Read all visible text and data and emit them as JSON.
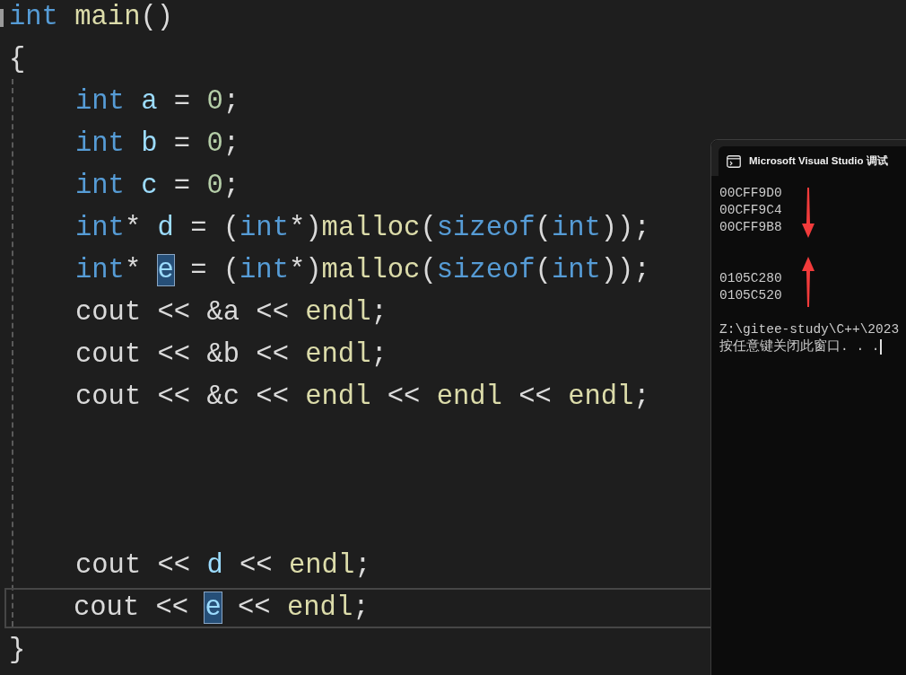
{
  "editor": {
    "blocks": [
      [
        {
          "indented": false,
          "current": false,
          "tokens": [
            {
              "kind": "kw",
              "text": "int "
            },
            {
              "kind": "fn",
              "text": "main"
            },
            {
              "kind": "op",
              "text": "()"
            }
          ]
        },
        {
          "indented": false,
          "current": false,
          "tokens": [
            {
              "kind": "op",
              "text": "{"
            }
          ]
        },
        {
          "indented": true,
          "current": false,
          "tokens": [
            {
              "kind": "kw",
              "text": "int "
            },
            {
              "kind": "var",
              "text": "a"
            },
            {
              "kind": "op",
              "text": " = "
            },
            {
              "kind": "num",
              "text": "0"
            },
            {
              "kind": "op",
              "text": ";"
            }
          ]
        },
        {
          "indented": true,
          "current": false,
          "tokens": [
            {
              "kind": "kw",
              "text": "int "
            },
            {
              "kind": "var",
              "text": "b"
            },
            {
              "kind": "op",
              "text": " = "
            },
            {
              "kind": "num",
              "text": "0"
            },
            {
              "kind": "op",
              "text": ";"
            }
          ]
        },
        {
          "indented": true,
          "current": false,
          "tokens": [
            {
              "kind": "kw",
              "text": "int "
            },
            {
              "kind": "var",
              "text": "c"
            },
            {
              "kind": "op",
              "text": " = "
            },
            {
              "kind": "num",
              "text": "0"
            },
            {
              "kind": "op",
              "text": ";"
            }
          ]
        },
        {
          "indented": true,
          "current": false,
          "tokens": [
            {
              "kind": "kw",
              "text": "int"
            },
            {
              "kind": "op",
              "text": "* "
            },
            {
              "kind": "var",
              "text": "d"
            },
            {
              "kind": "op",
              "text": " = ("
            },
            {
              "kind": "kw",
              "text": "int"
            },
            {
              "kind": "op",
              "text": "*)"
            },
            {
              "kind": "fn",
              "text": "malloc"
            },
            {
              "kind": "op",
              "text": "("
            },
            {
              "kind": "kw",
              "text": "sizeof"
            },
            {
              "kind": "op",
              "text": "("
            },
            {
              "kind": "kw",
              "text": "int"
            },
            {
              "kind": "op",
              "text": "));"
            }
          ]
        },
        {
          "indented": true,
          "current": false,
          "tokens": [
            {
              "kind": "kw",
              "text": "int"
            },
            {
              "kind": "op",
              "text": "* "
            },
            {
              "kind": "sel",
              "text": "e"
            },
            {
              "kind": "op",
              "text": " = ("
            },
            {
              "kind": "kw",
              "text": "int"
            },
            {
              "kind": "op",
              "text": "*)"
            },
            {
              "kind": "fn",
              "text": "malloc"
            },
            {
              "kind": "op",
              "text": "("
            },
            {
              "kind": "kw",
              "text": "sizeof"
            },
            {
              "kind": "op",
              "text": "("
            },
            {
              "kind": "kw",
              "text": "int"
            },
            {
              "kind": "op",
              "text": "));"
            }
          ]
        },
        {
          "indented": true,
          "current": false,
          "tokens": [
            {
              "kind": "op",
              "text": "cout << &a << "
            },
            {
              "kind": "fn",
              "text": "endl"
            },
            {
              "kind": "op",
              "text": ";"
            }
          ]
        },
        {
          "indented": true,
          "current": false,
          "tokens": [
            {
              "kind": "op",
              "text": "cout << &b << "
            },
            {
              "kind": "fn",
              "text": "endl"
            },
            {
              "kind": "op",
              "text": ";"
            }
          ]
        },
        {
          "indented": true,
          "current": false,
          "tokens": [
            {
              "kind": "op",
              "text": "cout << &c << "
            },
            {
              "kind": "fn",
              "text": "endl"
            },
            {
              "kind": "op",
              "text": " << "
            },
            {
              "kind": "fn",
              "text": "endl"
            },
            {
              "kind": "op",
              "text": " << "
            },
            {
              "kind": "fn",
              "text": "endl"
            },
            {
              "kind": "op",
              "text": ";"
            }
          ]
        }
      ],
      [
        {
          "indented": true,
          "current": false,
          "tokens": [
            {
              "kind": "op",
              "text": "cout << "
            },
            {
              "kind": "var",
              "text": "d"
            },
            {
              "kind": "op",
              "text": " << "
            },
            {
              "kind": "fn",
              "text": "endl"
            },
            {
              "kind": "op",
              "text": ";"
            }
          ]
        },
        {
          "indented": true,
          "current": true,
          "tokens": [
            {
              "kind": "op",
              "text": "cout << "
            },
            {
              "kind": "sel",
              "text": "e"
            },
            {
              "kind": "op",
              "text": " << "
            },
            {
              "kind": "fn",
              "text": "endl"
            },
            {
              "kind": "op",
              "text": ";"
            }
          ]
        },
        {
          "indented": false,
          "current": false,
          "tokens": [
            {
              "kind": "op",
              "text": "}"
            }
          ]
        }
      ]
    ]
  },
  "console": {
    "title": "Microsoft Visual Studio 调试",
    "blocks": [
      [
        "00CFF9D0",
        "00CFF9C4",
        "00CFF9B8"
      ],
      [
        "0105C280",
        "0105C520"
      ],
      [
        "Z:\\gitee-study\\C++\\2023",
        "按任意键关闭此窗口. . ."
      ]
    ]
  }
}
